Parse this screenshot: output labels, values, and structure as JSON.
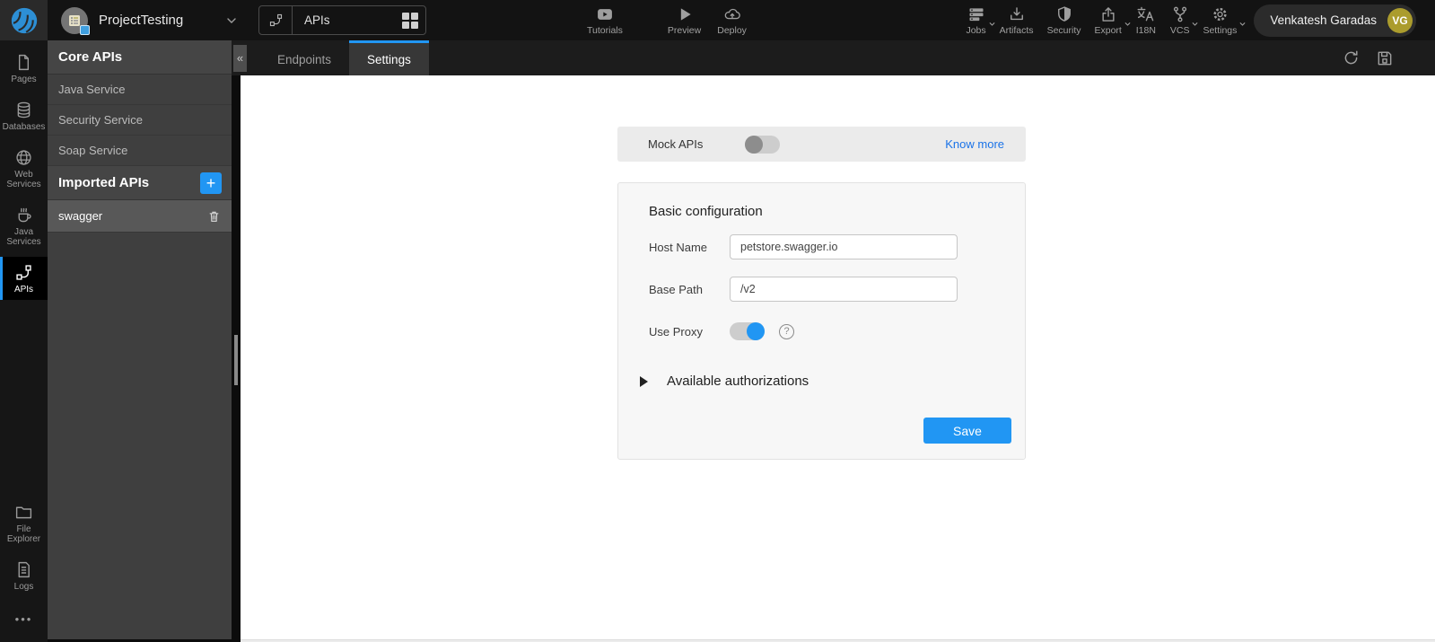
{
  "topbar": {
    "project_name": "ProjectTesting",
    "selector": {
      "label": "APIs"
    },
    "center_actions": [
      {
        "label": "Tutorials"
      },
      {
        "label": "Preview"
      },
      {
        "label": "Deploy"
      }
    ],
    "right_actions": [
      {
        "label": "Jobs"
      },
      {
        "label": "Artifacts"
      },
      {
        "label": "Security"
      },
      {
        "label": "Export"
      },
      {
        "label": "I18N"
      },
      {
        "label": "VCS"
      },
      {
        "label": "Settings"
      }
    ],
    "user": {
      "name": "Venkatesh Garadas",
      "initials": "VG"
    }
  },
  "rail": {
    "items": [
      {
        "label": "Pages"
      },
      {
        "label": "Databases"
      },
      {
        "label": "Web Services"
      },
      {
        "label": "Java Services"
      },
      {
        "label": "APIs"
      },
      {
        "label": "File Explorer"
      },
      {
        "label": "Logs"
      }
    ],
    "more_glyph": "•••"
  },
  "sidebar": {
    "core_header": "Core APIs",
    "collapse_glyph": "«",
    "core_items": [
      {
        "label": "Java Service"
      },
      {
        "label": "Security Service"
      },
      {
        "label": "Soap Service"
      }
    ],
    "imported_header": "Imported APIs",
    "add_glyph": "+",
    "imported_items": [
      {
        "label": "swagger",
        "selected": true
      }
    ]
  },
  "tabs": {
    "items": [
      {
        "label": "Endpoints",
        "active": false
      },
      {
        "label": "Settings",
        "active": true
      }
    ]
  },
  "settings_page": {
    "mock": {
      "label": "Mock APIs",
      "state": "off",
      "link_label": "Know more"
    },
    "card": {
      "title": "Basic configuration",
      "host_label": "Host Name",
      "host_value": "petstore.swagger.io",
      "base_label": "Base Path",
      "base_value": "/v2",
      "proxy_label": "Use Proxy",
      "proxy_state": "on",
      "help_glyph": "?",
      "auth_label": "Available authorizations",
      "save_label": "Save"
    }
  },
  "colors": {
    "accent": "#2196f3",
    "link": "#1a73e8",
    "avatar": "#ab9c2d",
    "topbar_bg": "#131313",
    "sidebar_bg": "#3f3f3f"
  }
}
